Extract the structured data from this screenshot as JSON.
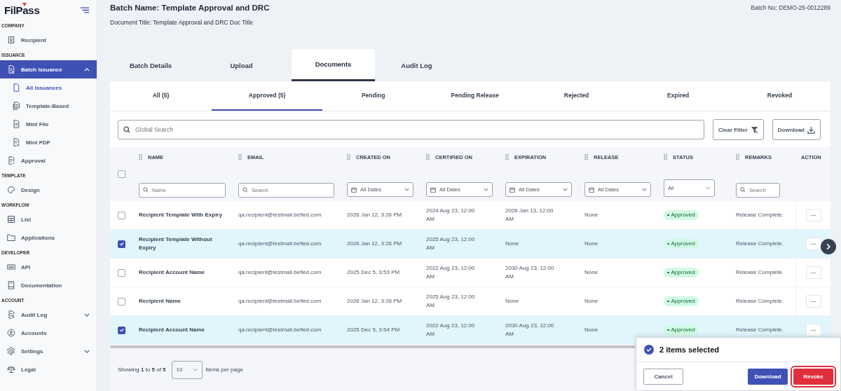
{
  "sidebar": {
    "logo": "FilPass",
    "sections": [
      {
        "title": "COMPANY",
        "items": [
          {
            "label": "Recipient",
            "selected": false
          }
        ]
      },
      {
        "title": "ISSUANCE",
        "items": [
          {
            "label": "Batch Issuance",
            "selected": true,
            "expanded": true,
            "children": [
              {
                "label": "All Issuances",
                "selected": true
              },
              {
                "label": "Template-Based",
                "selected": false
              },
              {
                "label": "Mint File",
                "selected": false
              },
              {
                "label": "Mint PDF",
                "selected": false
              }
            ]
          },
          {
            "label": "Approval",
            "selected": false
          }
        ]
      },
      {
        "title": "TEMPLATE",
        "items": [
          {
            "label": "Design",
            "selected": false
          }
        ]
      },
      {
        "title": "WORKFLOW",
        "items": [
          {
            "label": "List",
            "selected": false
          },
          {
            "label": "Applications",
            "selected": false
          }
        ]
      },
      {
        "title": "DEVELOPER",
        "items": [
          {
            "label": "API",
            "selected": false
          },
          {
            "label": "Documentation",
            "selected": false
          }
        ]
      },
      {
        "title": "ACCOUNT",
        "items": [
          {
            "label": "Audit Log",
            "selected": false,
            "expanded": false
          },
          {
            "label": "Accounts",
            "selected": false
          },
          {
            "label": "Settings",
            "selected": false,
            "expanded": false
          },
          {
            "label": "Legal",
            "selected": false
          }
        ]
      }
    ]
  },
  "header": {
    "batch_name": "Batch Name: Template Approval and DRC",
    "document_title": "Document Title: Template Approval and DRC Doc Title",
    "batch_no": "Batch No: DEMO-25-0012289"
  },
  "tabs": [
    {
      "label": "Batch Details",
      "selected": false
    },
    {
      "label": "Upload",
      "selected": false
    },
    {
      "label": "Documents",
      "selected": true
    },
    {
      "label": "Audit Log",
      "selected": false
    }
  ],
  "subtabs": [
    {
      "label": "All (5)",
      "selected": false
    },
    {
      "label": "Approved (5)",
      "selected": true
    },
    {
      "label": "Pending",
      "selected": false
    },
    {
      "label": "Pending Release",
      "selected": false
    },
    {
      "label": "Rejected",
      "selected": false
    },
    {
      "label": "Expired",
      "selected": false
    },
    {
      "label": "Revoked",
      "selected": false
    }
  ],
  "toolbar": {
    "search": {
      "placeholder": "Global Search"
    },
    "clear_filter": "Clear Filter",
    "download": "Download"
  },
  "table": {
    "select_all": {
      "checked": false
    },
    "columns": [
      {
        "label": "NAME",
        "draggable": true,
        "filter": {
          "kind": "search",
          "placeholder": "Name"
        }
      },
      {
        "label": "EMAIL",
        "draggable": true,
        "filter": {
          "kind": "search",
          "placeholder": "Search"
        }
      },
      {
        "label": "CREATED ON",
        "draggable": true,
        "filter": {
          "kind": "date",
          "value": "All Dates"
        }
      },
      {
        "label": "CERTIFIED ON",
        "draggable": true,
        "filter": {
          "kind": "date",
          "value": "All Dates"
        }
      },
      {
        "label": "EXPIRATION",
        "draggable": true,
        "filter": {
          "kind": "date",
          "value": "All Dates"
        }
      },
      {
        "label": "RELEASE",
        "draggable": true,
        "filter": {
          "kind": "date",
          "value": "All Dates"
        }
      },
      {
        "label": "STATUS",
        "draggable": true,
        "filter": {
          "kind": "select",
          "value": "All"
        }
      },
      {
        "label": "REMARKS",
        "draggable": true,
        "filter": {
          "kind": "search",
          "placeholder": "Search"
        }
      },
      {
        "label": "ACTION",
        "draggable": false
      }
    ],
    "rows": [
      {
        "selected": false,
        "name": "Recipient Template With Expiry",
        "email": "qa.recipient@testmail.befied.com",
        "created_on": "2026 Jan 12, 3:26 PM",
        "certified_on": "2024 Aug 23, 12:00 AM",
        "expiration": "2026 Jan 13, 12:00 AM",
        "release": "None",
        "status": "Approved",
        "remarks": "Release Complete."
      },
      {
        "selected": true,
        "name": "Recipient Template Without Expiry",
        "email": "qa.recipient@testmail.befied.com",
        "created_on": "2026 Jan 12, 3:26 PM",
        "certified_on": "2025 Aug 23, 12:00 AM",
        "expiration": "None",
        "release": "None",
        "status": "Approved",
        "remarks": "Release Complete."
      },
      {
        "selected": false,
        "name": "Recipient Account Name",
        "email": "qa.recipient@testmail.befied.com",
        "created_on": "2025 Dec 5, 3:53 PM",
        "certified_on": "2022 Aug 23, 12:00 AM",
        "expiration": "2030 Aug 23, 12:00 AM",
        "release": "None",
        "status": "Approved",
        "remarks": "Release Complete."
      },
      {
        "selected": false,
        "name": "Recipient Name",
        "email": "qa.recipient@testmail.befied.com",
        "created_on": "2026 Jan 12, 3:26 PM",
        "certified_on": "2025 Aug 23, 12:00 AM",
        "expiration": "None",
        "release": "None",
        "status": "Approved",
        "remarks": "Release Complete."
      },
      {
        "selected": true,
        "name": "Recipient Account Name",
        "email": "qa.recipient@testmail.befied.com",
        "created_on": "2025 Dec 5, 3:54 PM",
        "certified_on": "2022 Aug 23, 12:00 AM",
        "expiration": "2030 Aug 23, 12:00 AM",
        "release": "None",
        "status": "Approved",
        "remarks": "Release Complete."
      }
    ]
  },
  "pagination": {
    "summary": "Showing **1** to **5** of **5**",
    "page_size": "10",
    "page_size_label": "Items per page"
  },
  "selection_bar": {
    "count": "2 items selected",
    "buttons": [
      {
        "label": "Cancel",
        "kind": "secondary"
      },
      {
        "label": "Download",
        "kind": "primary"
      },
      {
        "label": "Revoke",
        "kind": "danger"
      }
    ]
  }
}
